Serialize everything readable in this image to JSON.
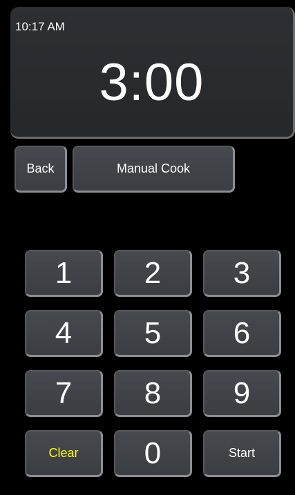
{
  "status": {
    "time": "10:17 AM"
  },
  "timer": {
    "display": "3:00"
  },
  "nav": {
    "back_label": "Back",
    "mode_label": "Manual Cook"
  },
  "keypad": {
    "keys": [
      "1",
      "2",
      "3",
      "4",
      "5",
      "6",
      "7",
      "8",
      "9",
      "0"
    ],
    "clear_label": "Clear",
    "start_label": "Start",
    "clear_color": "#ffff00"
  },
  "colors": {
    "background": "#000000",
    "button": "#404347",
    "text": "#ffffff"
  }
}
